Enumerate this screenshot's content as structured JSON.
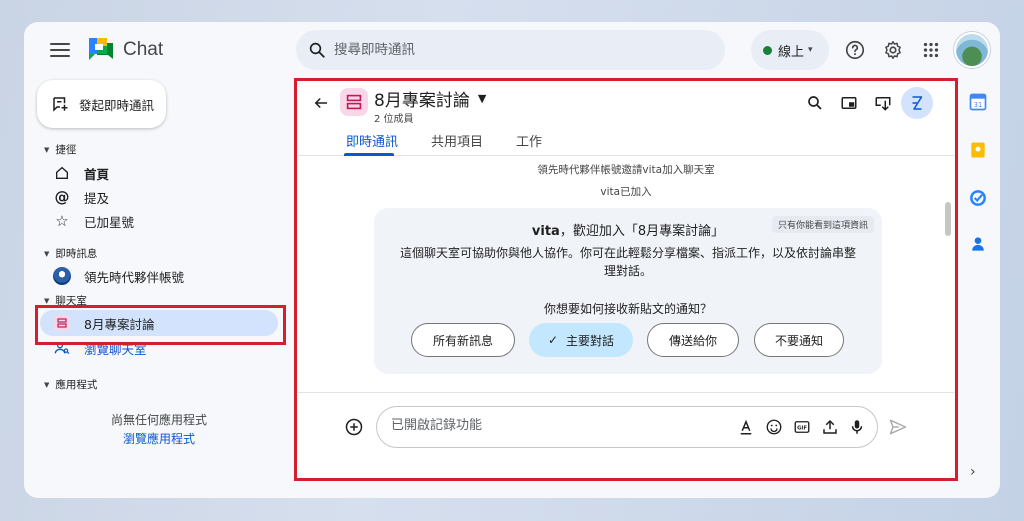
{
  "app": {
    "name": "Chat"
  },
  "search": {
    "placeholder": "搜尋即時通訊"
  },
  "status": {
    "label": "線上",
    "color": "#188038"
  },
  "icons": {
    "top": [
      "help-icon",
      "settings-icon",
      "apps-grid-icon"
    ],
    "rail": [
      "calendar-icon",
      "keep-icon",
      "tasks-icon",
      "contacts-icon"
    ]
  },
  "sidebar": {
    "new_chat_label": "發起即時通訊",
    "shortcuts": {
      "header": "捷徑",
      "items": [
        {
          "label": "首頁",
          "icon": "home-icon"
        },
        {
          "label": "提及",
          "icon": "at-icon"
        },
        {
          "label": "已加星號",
          "icon": "star-icon"
        }
      ]
    },
    "dms": {
      "header": "即時訊息",
      "items": [
        {
          "label": "領先時代夥伴帳號"
        }
      ]
    },
    "spaces": {
      "header": "聊天室",
      "items": [
        {
          "label": "8月專案討論",
          "active": true
        },
        {
          "label": "瀏覽聊天室"
        }
      ]
    },
    "apps": {
      "header": "應用程式",
      "empty_text": "尚無任何應用程式",
      "browse_link": "瀏覽應用程式"
    }
  },
  "space": {
    "title": "8月專案討論",
    "member_count": "2 位成員",
    "tabs": [
      {
        "label": "即時通訊",
        "active": true
      },
      {
        "label": "共用項目"
      },
      {
        "label": "工作"
      }
    ]
  },
  "messages": {
    "system": [
      "領先時代夥伴帳號邀請vita加入聊天室",
      "vita已加入"
    ],
    "welcome": {
      "user": "vita",
      "title_rest": "，歡迎加入「8月專案討論」",
      "private_note": "只有你能看到這項資訊",
      "body": "這個聊天室可協助你與他人協作。你可在此輕鬆分享檔案、指派工作，以及依討論串整理對話。",
      "question": "你想要如何接收新貼文的通知？",
      "options": [
        {
          "label": "所有新訊息"
        },
        {
          "label": "主要對話",
          "selected": true
        },
        {
          "label": "傳送給你"
        },
        {
          "label": "不要通知"
        }
      ]
    }
  },
  "composer": {
    "placeholder": "已開啟記錄功能"
  },
  "highlight_color": "#d4202c",
  "accent_color": "#0b57d0"
}
